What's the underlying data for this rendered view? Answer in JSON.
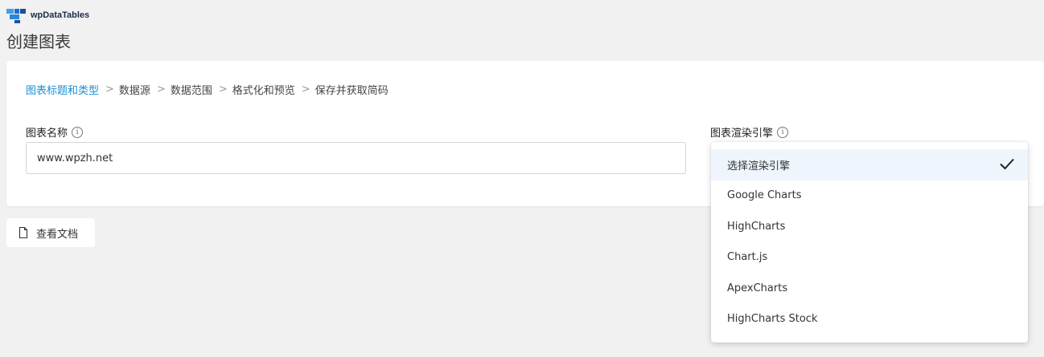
{
  "brand": {
    "name": "wpDataTables",
    "logo_icon": "wpdatatables-logo-icon"
  },
  "page": {
    "title": "创建图表"
  },
  "wizard": {
    "steps": [
      {
        "label": "图表标题和类型",
        "active": true
      },
      {
        "label": "数据源",
        "active": false
      },
      {
        "label": "数据范围",
        "active": false
      },
      {
        "label": "格式化和预览",
        "active": false
      },
      {
        "label": "保存并获取简码",
        "active": false
      }
    ],
    "separator": ">"
  },
  "form": {
    "chart_name_label": "图表名称",
    "chart_name_value": "www.wpzh.net",
    "engine_label": "图表渲染引擎",
    "info_icon": "i"
  },
  "engine_dropdown": {
    "selected_index": 0,
    "options": [
      "选择渲染引擎",
      "Google Charts",
      "HighCharts",
      "Chart.js",
      "ApexCharts",
      "HighCharts Stock"
    ]
  },
  "doc_button": {
    "label": "查看文档",
    "icon": "document-icon"
  },
  "colors": {
    "accent": "#1a8fd6",
    "selected_bg": "#eef5fc",
    "page_bg": "#f1f1f1"
  }
}
